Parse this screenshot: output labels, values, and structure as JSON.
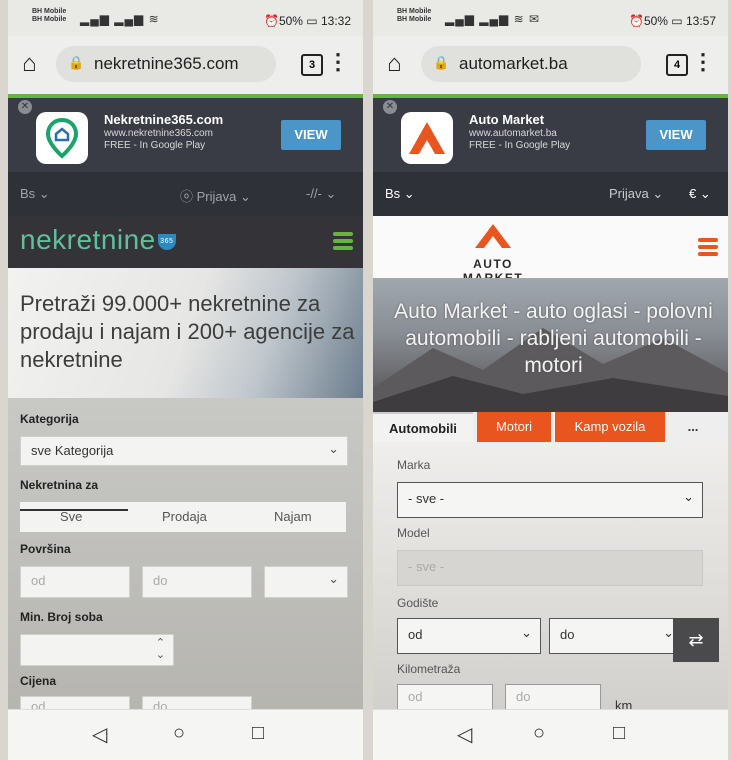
{
  "colors": {
    "nek_accent": "#67b443",
    "nek_logo": "#5fc09a",
    "am_orange": "#e8551e",
    "view_button": "#4b95c9"
  },
  "left": {
    "status": {
      "carrier1": "BH Mobile",
      "carrier2": "BH Mobile",
      "right": "⏰50% ▭ 13:32"
    },
    "browser": {
      "url": "nekretnine365.com",
      "tab_count": "3"
    },
    "banner": {
      "title": "Nekretnine365.com",
      "url": "www.nekretnine365.com",
      "free": "FREE - In Google Play",
      "view": "VIEW"
    },
    "topnav": {
      "lang": "Bs",
      "login": "Prijava",
      "currency": "-//-"
    },
    "logo": {
      "text": "nekretnine",
      "badge": "365"
    },
    "hero": {
      "title": "Pretraži 99.000+ nekretnine za prodaju i najam i 200+ agencije za nekretnine"
    },
    "form": {
      "category_label": "Kategorija",
      "category_value": "sve Kategorija",
      "purpose_label": "Nekretnina za",
      "purpose_options": [
        "Sve",
        "Prodaja",
        "Najam"
      ],
      "area_label": "Površina",
      "area_from": "od",
      "area_to": "do",
      "rooms_label": "Min. Broj soba",
      "price_label": "Cijena",
      "price_from": "od",
      "price_to": "do"
    }
  },
  "right": {
    "status": {
      "carrier1": "BH Mobile",
      "carrier2": "BH Mobile",
      "right": "⏰50% ▭ 13:57"
    },
    "browser": {
      "url": "automarket.ba",
      "tab_count": "4"
    },
    "banner": {
      "title": "Auto Market",
      "url": "www.automarket.ba",
      "free": "FREE - In Google Play",
      "view": "VIEW"
    },
    "topnav": {
      "lang": "Bs",
      "login": "Prijava",
      "currency": "€"
    },
    "logo": {
      "text": "AUTO MARKET"
    },
    "hero": {
      "title": "Auto Market - auto oglasi - polovni automobili - rabljeni automobili - motori"
    },
    "tabs": [
      "Automobili",
      "Motori",
      "Kamp vozila",
      "..."
    ],
    "form": {
      "make_label": "Marka",
      "make_value": "- sve -",
      "model_label": "Model",
      "model_value": "- sve -",
      "year_label": "Godište",
      "year_from": "od",
      "year_to": "do",
      "km_label": "Kilometraža",
      "km_from": "od",
      "km_to": "do",
      "km_unit": "km"
    }
  }
}
